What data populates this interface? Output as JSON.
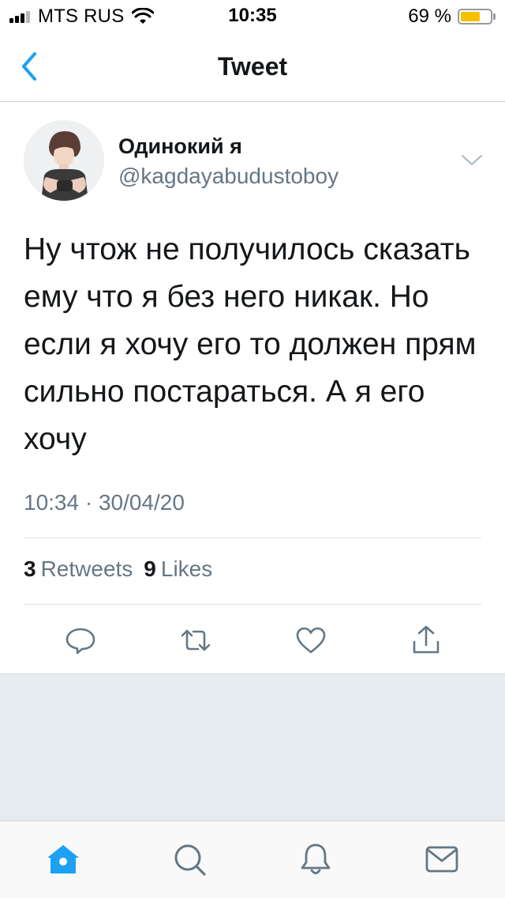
{
  "status_bar": {
    "carrier": "MTS RUS",
    "time": "10:35",
    "battery_percent": "69 %",
    "battery_level": 0.69,
    "signal_bars_active": 3,
    "signal_bars_total": 4
  },
  "nav": {
    "title": "Tweet"
  },
  "tweet": {
    "author_name": "Одинокий я",
    "author_handle": "@kagdayabudustoboy",
    "text": "Ну чтож не получилось сказать ему что я без него никак. Но если я хочу его то должен прям сильно постараться. А я его хочу",
    "timestamp": "10:34 · 30/04/20",
    "retweet_count": "3",
    "retweet_label": "Retweets",
    "like_count": "9",
    "like_label": "Likes"
  },
  "actions": [
    "reply-icon",
    "retweet-icon",
    "like-icon",
    "share-icon"
  ],
  "tabs": [
    "home-icon",
    "search-icon",
    "notifications-icon",
    "messages-icon"
  ],
  "colors": {
    "accent": "#1da1f2",
    "icon_grey": "#657786",
    "text": "#14171a",
    "battery": "#f5c000",
    "background_grey": "#e6ecf0"
  }
}
